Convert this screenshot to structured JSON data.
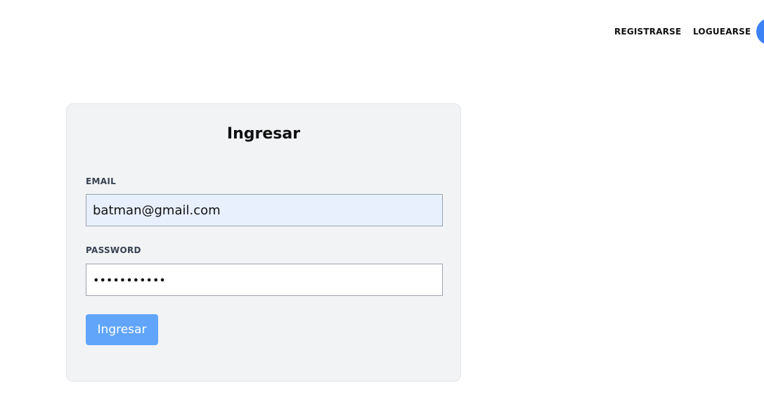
{
  "navbar": {
    "register_label": "REGISTRARSE",
    "login_label": "LOGUEARSE",
    "avatar_color": "#3b82f6"
  },
  "login_form": {
    "title": "Ingresar",
    "email_label": "EMAIL",
    "email_value": "batman@gmail.com",
    "password_label": "PASSWORD",
    "password_value": "batman12345",
    "submit_label": "Ingresar",
    "submit_color": "#60a5fa"
  }
}
